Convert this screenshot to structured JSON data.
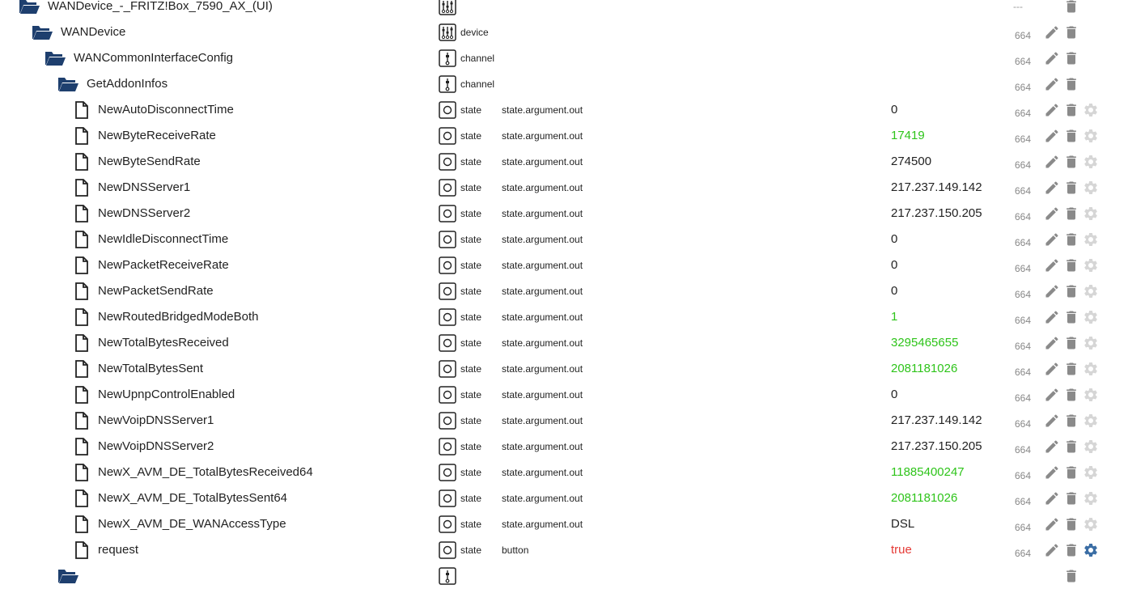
{
  "colors": {
    "folder": "#1e3f6e",
    "value_ack_false": "#2ec41a",
    "value_true": "#e53935",
    "action_icon": "#8a8a8a",
    "gear_active": "#3b6ea5"
  },
  "rows": [
    {
      "level": 0,
      "kind": "folder",
      "name": "WANDevice_-_FRITZ!Box_7590_AX_(UI)",
      "type_icon": "device-icon",
      "type_label": "",
      "role": "",
      "value": "",
      "number": "---",
      "actions": [
        "delete"
      ]
    },
    {
      "level": 1,
      "kind": "folder",
      "name": "WANDevice",
      "type_icon": "device-icon",
      "type_label": "device",
      "role": "",
      "value": "",
      "number": "664",
      "actions": [
        "edit",
        "delete"
      ]
    },
    {
      "level": 2,
      "kind": "folder",
      "name": "WANCommonInterfaceConfig",
      "type_icon": "channel-icon",
      "type_label": "channel",
      "role": "",
      "value": "",
      "number": "664",
      "actions": [
        "edit",
        "delete"
      ]
    },
    {
      "level": 3,
      "kind": "folder",
      "name": "GetAddonInfos",
      "type_icon": "channel-icon",
      "type_label": "channel",
      "role": "",
      "value": "",
      "number": "664",
      "actions": [
        "edit",
        "delete"
      ]
    },
    {
      "level": 4,
      "kind": "file",
      "name": "NewAutoDisconnectTime",
      "type_icon": "state-icon",
      "type_label": "state",
      "role": "state.argument.out",
      "value": "0",
      "value_color": "",
      "number": "664",
      "actions": [
        "edit",
        "delete",
        "gear"
      ]
    },
    {
      "level": 4,
      "kind": "file",
      "name": "NewByteReceiveRate",
      "type_icon": "state-icon",
      "type_label": "state",
      "role": "state.argument.out",
      "value": "17419",
      "value_color": "green",
      "number": "664",
      "actions": [
        "edit",
        "delete",
        "gear"
      ]
    },
    {
      "level": 4,
      "kind": "file",
      "name": "NewByteSendRate",
      "type_icon": "state-icon",
      "type_label": "state",
      "role": "state.argument.out",
      "value": "274500",
      "value_color": "",
      "number": "664",
      "actions": [
        "edit",
        "delete",
        "gear"
      ]
    },
    {
      "level": 4,
      "kind": "file",
      "name": "NewDNSServer1",
      "type_icon": "state-icon",
      "type_label": "state",
      "role": "state.argument.out",
      "value": "217.237.149.142",
      "value_color": "",
      "number": "664",
      "actions": [
        "edit",
        "delete",
        "gear"
      ]
    },
    {
      "level": 4,
      "kind": "file",
      "name": "NewDNSServer2",
      "type_icon": "state-icon",
      "type_label": "state",
      "role": "state.argument.out",
      "value": "217.237.150.205",
      "value_color": "",
      "number": "664",
      "actions": [
        "edit",
        "delete",
        "gear"
      ]
    },
    {
      "level": 4,
      "kind": "file",
      "name": "NewIdleDisconnectTime",
      "type_icon": "state-icon",
      "type_label": "state",
      "role": "state.argument.out",
      "value": "0",
      "value_color": "",
      "number": "664",
      "actions": [
        "edit",
        "delete",
        "gear"
      ]
    },
    {
      "level": 4,
      "kind": "file",
      "name": "NewPacketReceiveRate",
      "type_icon": "state-icon",
      "type_label": "state",
      "role": "state.argument.out",
      "value": "0",
      "value_color": "",
      "number": "664",
      "actions": [
        "edit",
        "delete",
        "gear"
      ]
    },
    {
      "level": 4,
      "kind": "file",
      "name": "NewPacketSendRate",
      "type_icon": "state-icon",
      "type_label": "state",
      "role": "state.argument.out",
      "value": "0",
      "value_color": "",
      "number": "664",
      "actions": [
        "edit",
        "delete",
        "gear"
      ]
    },
    {
      "level": 4,
      "kind": "file",
      "name": "NewRoutedBridgedModeBoth",
      "type_icon": "state-icon",
      "type_label": "state",
      "role": "state.argument.out",
      "value": "1",
      "value_color": "green",
      "number": "664",
      "actions": [
        "edit",
        "delete",
        "gear"
      ]
    },
    {
      "level": 4,
      "kind": "file",
      "name": "NewTotalBytesReceived",
      "type_icon": "state-icon",
      "type_label": "state",
      "role": "state.argument.out",
      "value": "3295465655",
      "value_color": "green",
      "number": "664",
      "actions": [
        "edit",
        "delete",
        "gear"
      ]
    },
    {
      "level": 4,
      "kind": "file",
      "name": "NewTotalBytesSent",
      "type_icon": "state-icon",
      "type_label": "state",
      "role": "state.argument.out",
      "value": "2081181026",
      "value_color": "green",
      "number": "664",
      "actions": [
        "edit",
        "delete",
        "gear"
      ]
    },
    {
      "level": 4,
      "kind": "file",
      "name": "NewUpnpControlEnabled",
      "type_icon": "state-icon",
      "type_label": "state",
      "role": "state.argument.out",
      "value": "0",
      "value_color": "",
      "number": "664",
      "actions": [
        "edit",
        "delete",
        "gear"
      ]
    },
    {
      "level": 4,
      "kind": "file",
      "name": "NewVoipDNSServer1",
      "type_icon": "state-icon",
      "type_label": "state",
      "role": "state.argument.out",
      "value": "217.237.149.142",
      "value_color": "",
      "number": "664",
      "actions": [
        "edit",
        "delete",
        "gear"
      ]
    },
    {
      "level": 4,
      "kind": "file",
      "name": "NewVoipDNSServer2",
      "type_icon": "state-icon",
      "type_label": "state",
      "role": "state.argument.out",
      "value": "217.237.150.205",
      "value_color": "",
      "number": "664",
      "actions": [
        "edit",
        "delete",
        "gear"
      ]
    },
    {
      "level": 4,
      "kind": "file",
      "name": "NewX_AVM_DE_TotalBytesReceived64",
      "type_icon": "state-icon",
      "type_label": "state",
      "role": "state.argument.out",
      "value": "11885400247",
      "value_color": "green",
      "number": "664",
      "actions": [
        "edit",
        "delete",
        "gear"
      ]
    },
    {
      "level": 4,
      "kind": "file",
      "name": "NewX_AVM_DE_TotalBytesSent64",
      "type_icon": "state-icon",
      "type_label": "state",
      "role": "state.argument.out",
      "value": "2081181026",
      "value_color": "green",
      "number": "664",
      "actions": [
        "edit",
        "delete",
        "gear"
      ]
    },
    {
      "level": 4,
      "kind": "file",
      "name": "NewX_AVM_DE_WANAccessType",
      "type_icon": "state-icon",
      "type_label": "state",
      "role": "state.argument.out",
      "value": "DSL",
      "value_color": "",
      "number": "664",
      "actions": [
        "edit",
        "delete",
        "gear"
      ]
    },
    {
      "level": 4,
      "kind": "file",
      "name": "request",
      "type_icon": "state-icon",
      "type_label": "state",
      "role": "button",
      "value": "true",
      "value_color": "red",
      "number": "664",
      "actions": [
        "edit",
        "delete",
        "gear-active"
      ]
    },
    {
      "level": 3,
      "kind": "folder",
      "name": "",
      "type_icon": "channel-icon",
      "type_label": "",
      "role": "",
      "value": "",
      "number": "",
      "actions": [
        "delete"
      ]
    }
  ]
}
